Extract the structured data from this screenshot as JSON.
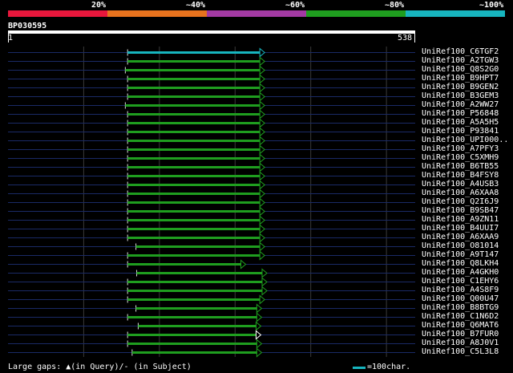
{
  "legend": {
    "segments": [
      {
        "color": "#e8173c",
        "label": "20%"
      },
      {
        "color": "#e8731e",
        "label": "~40%"
      },
      {
        "color": "#a33aa3",
        "label": "~60%"
      },
      {
        "color": "#1f9e1f",
        "label": "~80%"
      },
      {
        "color": "#17b5bf",
        "label": "~100%"
      }
    ]
  },
  "query": {
    "id": "BP030595",
    "start": "1",
    "end": "538",
    "length": 538
  },
  "alignments": [
    {
      "label": "UniRef100_C6TGF2",
      "start": 158,
      "end": 338,
      "color": "#17b5bf",
      "arrow": "#17b5bf"
    },
    {
      "label": "UniRef100_A2TGW3",
      "start": 158,
      "end": 338,
      "color": "#1f9e1f",
      "arrow": "#1f9e1f"
    },
    {
      "label": "UniRef100_Q8S2G0",
      "start": 155,
      "end": 338,
      "color": "#1f9e1f",
      "arrow": "#1f9e1f"
    },
    {
      "label": "UniRef100_B9HPT7",
      "start": 158,
      "end": 338,
      "color": "#1f9e1f",
      "arrow": "#1f9e1f"
    },
    {
      "label": "UniRef100_B9GEN2",
      "start": 158,
      "end": 338,
      "color": "#1f9e1f",
      "arrow": "#1f9e1f"
    },
    {
      "label": "UniRef100_B3GEM3",
      "start": 158,
      "end": 338,
      "color": "#1f9e1f",
      "arrow": "#1f9e1f"
    },
    {
      "label": "UniRef100_A2WW27",
      "start": 155,
      "end": 338,
      "color": "#1f9e1f",
      "arrow": "#1f9e1f"
    },
    {
      "label": "UniRef100_P56848",
      "start": 158,
      "end": 338,
      "color": "#1f9e1f",
      "arrow": "#1f9e1f"
    },
    {
      "label": "UniRef100_A5A5H5",
      "start": 158,
      "end": 338,
      "color": "#1f9e1f",
      "arrow": "#1f9e1f"
    },
    {
      "label": "UniRef100_P93841",
      "start": 158,
      "end": 338,
      "color": "#1f9e1f",
      "arrow": "#1f9e1f"
    },
    {
      "label": "UniRef100_UPI000..",
      "start": 158,
      "end": 338,
      "color": "#1f9e1f",
      "arrow": "#1f9e1f"
    },
    {
      "label": "UniRef100_A7PFY3",
      "start": 158,
      "end": 338,
      "color": "#1f9e1f",
      "arrow": "#1f9e1f"
    },
    {
      "label": "UniRef100_C5XMH9",
      "start": 158,
      "end": 338,
      "color": "#1f9e1f",
      "arrow": "#1f9e1f"
    },
    {
      "label": "UniRef100_B6TB55",
      "start": 158,
      "end": 338,
      "color": "#1f9e1f",
      "arrow": "#1f9e1f"
    },
    {
      "label": "UniRef100_B4FSY8",
      "start": 158,
      "end": 338,
      "color": "#1f9e1f",
      "arrow": "#1f9e1f"
    },
    {
      "label": "UniRef100_A4USB3",
      "start": 158,
      "end": 338,
      "color": "#1f9e1f",
      "arrow": "#1f9e1f"
    },
    {
      "label": "UniRef100_A6XAA8",
      "start": 158,
      "end": 338,
      "color": "#1f9e1f",
      "arrow": "#1f9e1f"
    },
    {
      "label": "UniRef100_Q2I6J9",
      "start": 158,
      "end": 338,
      "color": "#1f9e1f",
      "arrow": "#1f9e1f"
    },
    {
      "label": "UniRef100_B9SB47",
      "start": 158,
      "end": 338,
      "color": "#1f9e1f",
      "arrow": "#1f9e1f"
    },
    {
      "label": "UniRef100_A9ZN11",
      "start": 158,
      "end": 338,
      "color": "#1f9e1f",
      "arrow": "#1f9e1f"
    },
    {
      "label": "UniRef100_B4UUI7",
      "start": 158,
      "end": 338,
      "color": "#1f9e1f",
      "arrow": "#1f9e1f"
    },
    {
      "label": "UniRef100_A6XAA9",
      "start": 158,
      "end": 338,
      "color": "#1f9e1f",
      "arrow": "#1f9e1f"
    },
    {
      "label": "UniRef100_O81014",
      "start": 169,
      "end": 338,
      "color": "#1f9e1f",
      "arrow": "#1f9e1f"
    },
    {
      "label": "UniRef100_A9T147",
      "start": 158,
      "end": 338,
      "color": "#1f9e1f",
      "arrow": "#1f9e1f"
    },
    {
      "label": "UniRef100_Q8LKH4",
      "start": 158,
      "end": 313,
      "color": "#1f9e1f",
      "arrow": "#1f9e1f"
    },
    {
      "label": "UniRef100_A4GKH0",
      "start": 170,
      "end": 341,
      "color": "#1f9e1f",
      "arrow": "#1f9e1f"
    },
    {
      "label": "UniRef100_C1EHY6",
      "start": 158,
      "end": 341,
      "color": "#1f9e1f",
      "arrow": "#1f9e1f"
    },
    {
      "label": "UniRef100_A4S8F9",
      "start": 158,
      "end": 341,
      "color": "#1f9e1f",
      "arrow": "#1f9e1f"
    },
    {
      "label": "UniRef100_Q00U47",
      "start": 158,
      "end": 338,
      "color": "#1f9e1f",
      "arrow": "#1f9e1f"
    },
    {
      "label": "UniRef100_B8BTG9",
      "start": 169,
      "end": 334,
      "color": "#1f9e1f",
      "arrow": "#1f9e1f"
    },
    {
      "label": "UniRef100_C1N6D2",
      "start": 158,
      "end": 334,
      "color": "#1f9e1f",
      "arrow": "#1f9e1f"
    },
    {
      "label": "UniRef100_Q6MAT6",
      "start": 172,
      "end": 333,
      "color": "#1f9e1f",
      "arrow": "#1f9e1f"
    },
    {
      "label": "UniRef100_B7FUR0",
      "start": 158,
      "end": 333,
      "color": "#1f9e1f",
      "arrow": "#ffffff"
    },
    {
      "label": "UniRef100_A8J0V1",
      "start": 158,
      "end": 334,
      "color": "#1f9e1f",
      "arrow": "#1f9e1f"
    },
    {
      "label": "UniRef100_C5L3L8",
      "start": 164,
      "end": 334,
      "color": "#1f9e1f",
      "arrow": "#1f9e1f"
    }
  ],
  "footer": {
    "gaps_text": "Large gaps: ▲(in Query)/- (in Subject)",
    "scale_text": "=100char.",
    "scale_color": "#17b5bf"
  },
  "colors": {
    "background": "#000000",
    "row_guide": "#1a2a66",
    "grid": "#3a3a3a"
  }
}
